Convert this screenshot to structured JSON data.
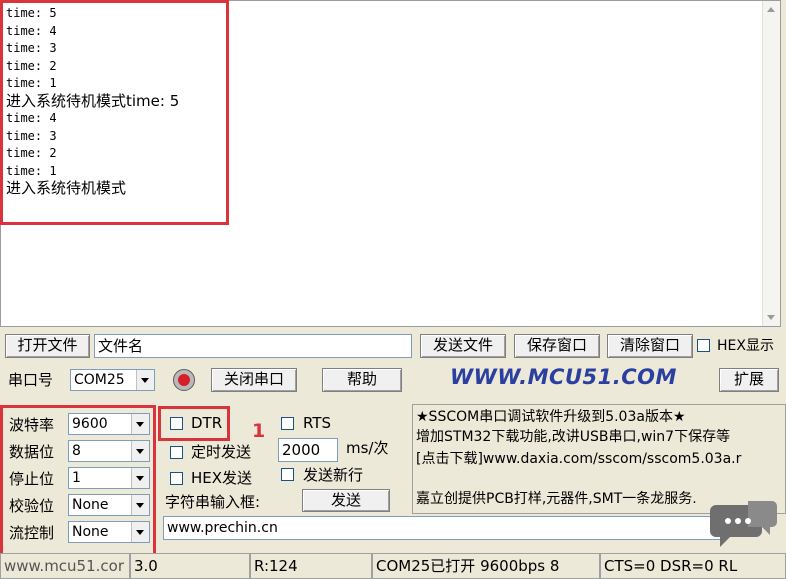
{
  "receive_area": {
    "lines": [
      {
        "text": "time: 5",
        "kind": "mono"
      },
      {
        "text": "time: 4",
        "kind": "mono"
      },
      {
        "text": "time: 3",
        "kind": "mono"
      },
      {
        "text": "time: 2",
        "kind": "mono"
      },
      {
        "text": "time: 1",
        "kind": "mono"
      },
      {
        "text": "进入系统待机模式time: 5",
        "kind": "cn"
      },
      {
        "text": "time: 4",
        "kind": "mono"
      },
      {
        "text": "time: 3",
        "kind": "mono"
      },
      {
        "text": "time: 2",
        "kind": "mono"
      },
      {
        "text": "time: 1",
        "kind": "mono"
      },
      {
        "text": "进入系统待机模式",
        "kind": "cn"
      }
    ]
  },
  "file_row": {
    "open_file": "打开文件",
    "file_name": "文件名",
    "send_file": "发送文件",
    "save_window": "保存窗口",
    "clear_window": "清除窗口",
    "hex_display": "HEX显示"
  },
  "port_row": {
    "port_label": "串口号",
    "port_value": "COM25",
    "close_port": "关闭串口",
    "help": "帮助",
    "brand": "WWW.MCU51.COM",
    "expand": "扩展"
  },
  "settings": {
    "baud_label": "波特率",
    "baud_value": "9600",
    "data_label": "数据位",
    "data_value": "8",
    "stop_label": "停止位",
    "stop_value": "1",
    "parity_label": "校验位",
    "parity_value": "None",
    "flow_label": "流控制",
    "flow_value": "None"
  },
  "controls": {
    "dtr": "DTR",
    "rts": "RTS",
    "timed_send": "定时发送",
    "interval_value": "2000",
    "interval_unit": "ms/次",
    "hex_send": "HEX发送",
    "send_newline": "发送新行",
    "input_label": "字符串输入框:",
    "send_button": "发送",
    "annotation": "1"
  },
  "ad_panel": {
    "line1": "★SSCOM串口调试软件升级到5.03a版本★",
    "line2": "增加STM32下载功能,改讲USB串口,win7下保存等",
    "line3": "[点击下载]www.daxia.com/sscom/sscom5.03a.r",
    "line4": "嘉立创提供PCB打样,元器件,SMT一条龙服务."
  },
  "send_input": {
    "value": "www.prechin.cn"
  },
  "status_bar": {
    "url": "www.mcu51.cor",
    "version": "3.0",
    "received": "R:124",
    "port_status": "COM25已打开  9600bps  8",
    "signals": "CTS=0 DSR=0 RL"
  },
  "colors": {
    "annotation_red": "#d9343b",
    "brand_blue": "#2a3fa0",
    "brand_red": "#d12a2a"
  }
}
